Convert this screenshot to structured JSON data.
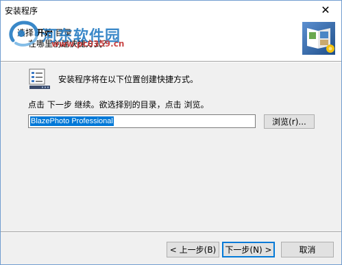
{
  "window": {
    "title": "安装程序",
    "close_glyph": "✕"
  },
  "watermark": {
    "title": "河东软件园",
    "url": "www.pc0359.cn"
  },
  "header": {
    "heading_prefix": "选择",
    "heading_bold": "开始",
    "heading_suffix": "目录",
    "subtitle": "在哪里创建快捷方式？",
    "logo_icon": "photo-album-icon"
  },
  "content": {
    "icon": "install-list-icon",
    "description": "安装程序将在以下位置创建快捷方式。",
    "instruction": "点击 下一步 继续。欲选择别的目录，点击 浏览。",
    "folder_value": "BlazePhoto Professional",
    "browse_label": "浏览(r)..."
  },
  "footer": {
    "back_label": "< 上一步(B)",
    "next_label": "下一步(N) >",
    "cancel_label": "取消"
  },
  "colors": {
    "accent": "#0078d7",
    "watermark_blue": "#2a7ec4",
    "watermark_red": "#c53a3a"
  }
}
